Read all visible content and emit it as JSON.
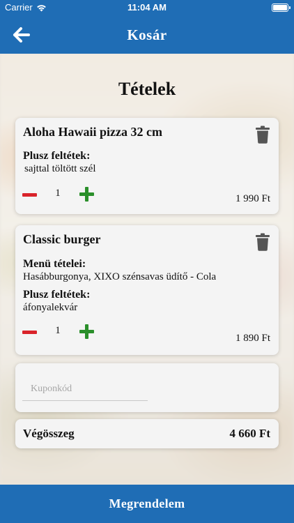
{
  "status_bar": {
    "carrier": "Carrier",
    "time": "11:04 AM"
  },
  "nav": {
    "title": "Kosár"
  },
  "section_title": "Tételek",
  "items": [
    {
      "name": "Aloha Hawaii pizza 32 cm",
      "extras_label": "Plusz feltétek:",
      "extras": "sajttal töltött szél",
      "quantity": "1",
      "price": "1 990 Ft"
    },
    {
      "name": "Classic burger",
      "menu_label": "Menü tételei:",
      "menu_items": "Hasábburgonya, XIXO szénsavas üdítő - Cola",
      "extras_label": "Plusz feltétek:",
      "extras": "áfonyalekvár",
      "quantity": "1",
      "price": "1 890 Ft"
    }
  ],
  "coupon": {
    "placeholder": "Kuponkód",
    "value": ""
  },
  "total": {
    "label": "Végösszeg",
    "value": "4 660 Ft"
  },
  "order_button": {
    "label": "Megrendelem"
  },
  "colors": {
    "primary": "#1f6db5",
    "minus": "#d9232a",
    "plus": "#2a8f2a",
    "trash": "#555555"
  }
}
